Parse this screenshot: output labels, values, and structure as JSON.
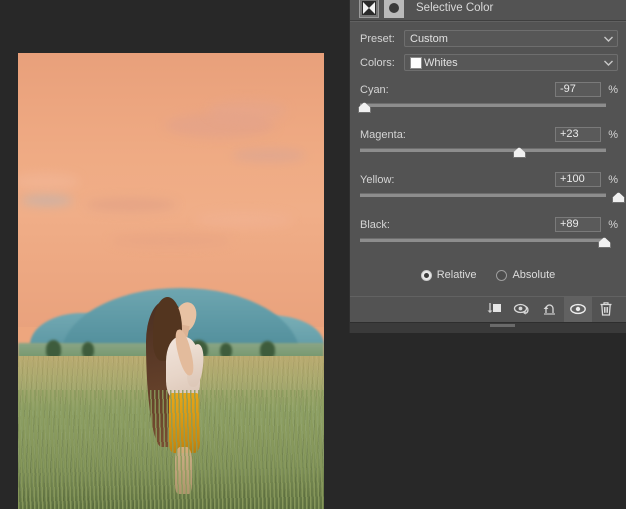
{
  "app": {
    "background_color": "#282828",
    "panel_color": "#535353"
  },
  "panel": {
    "title": "Selective Color",
    "mask_thumbnail_icon": "adjustment-mask-icon",
    "layer_thumbnail_icon": "selective-color-circle-icon",
    "preset": {
      "label": "Preset:",
      "value": "Custom",
      "chevron_icon": "chevron-down-icon"
    },
    "colors": {
      "label": "Colors:",
      "value": "Whites",
      "swatch_color": "#ffffff",
      "chevron_icon": "chevron-down-icon"
    },
    "sliders": [
      {
        "name": "Cyan:",
        "value": "-97",
        "unit": "%",
        "percent": 1.5
      },
      {
        "name": "Magenta:",
        "value": "+23",
        "unit": "%",
        "percent": 61.5
      },
      {
        "name": "Yellow:",
        "value": "+100",
        "unit": "%",
        "percent": 100
      },
      {
        "name": "Black:",
        "value": "+89",
        "unit": "%",
        "percent": 94.5
      }
    ],
    "method": {
      "relative_label": "Relative",
      "absolute_label": "Absolute",
      "selected": "Relative"
    },
    "footer_buttons": [
      {
        "name": "clip-to-layer-icon",
        "active": false
      },
      {
        "name": "view-previous-state-icon",
        "active": false
      },
      {
        "name": "reset-icon",
        "active": false
      },
      {
        "name": "visibility-eye-icon",
        "active": true
      },
      {
        "name": "delete-trash-icon",
        "active": false
      }
    ]
  },
  "canvas": {
    "image_name": "woman-in-field-at-sunset-photo"
  }
}
